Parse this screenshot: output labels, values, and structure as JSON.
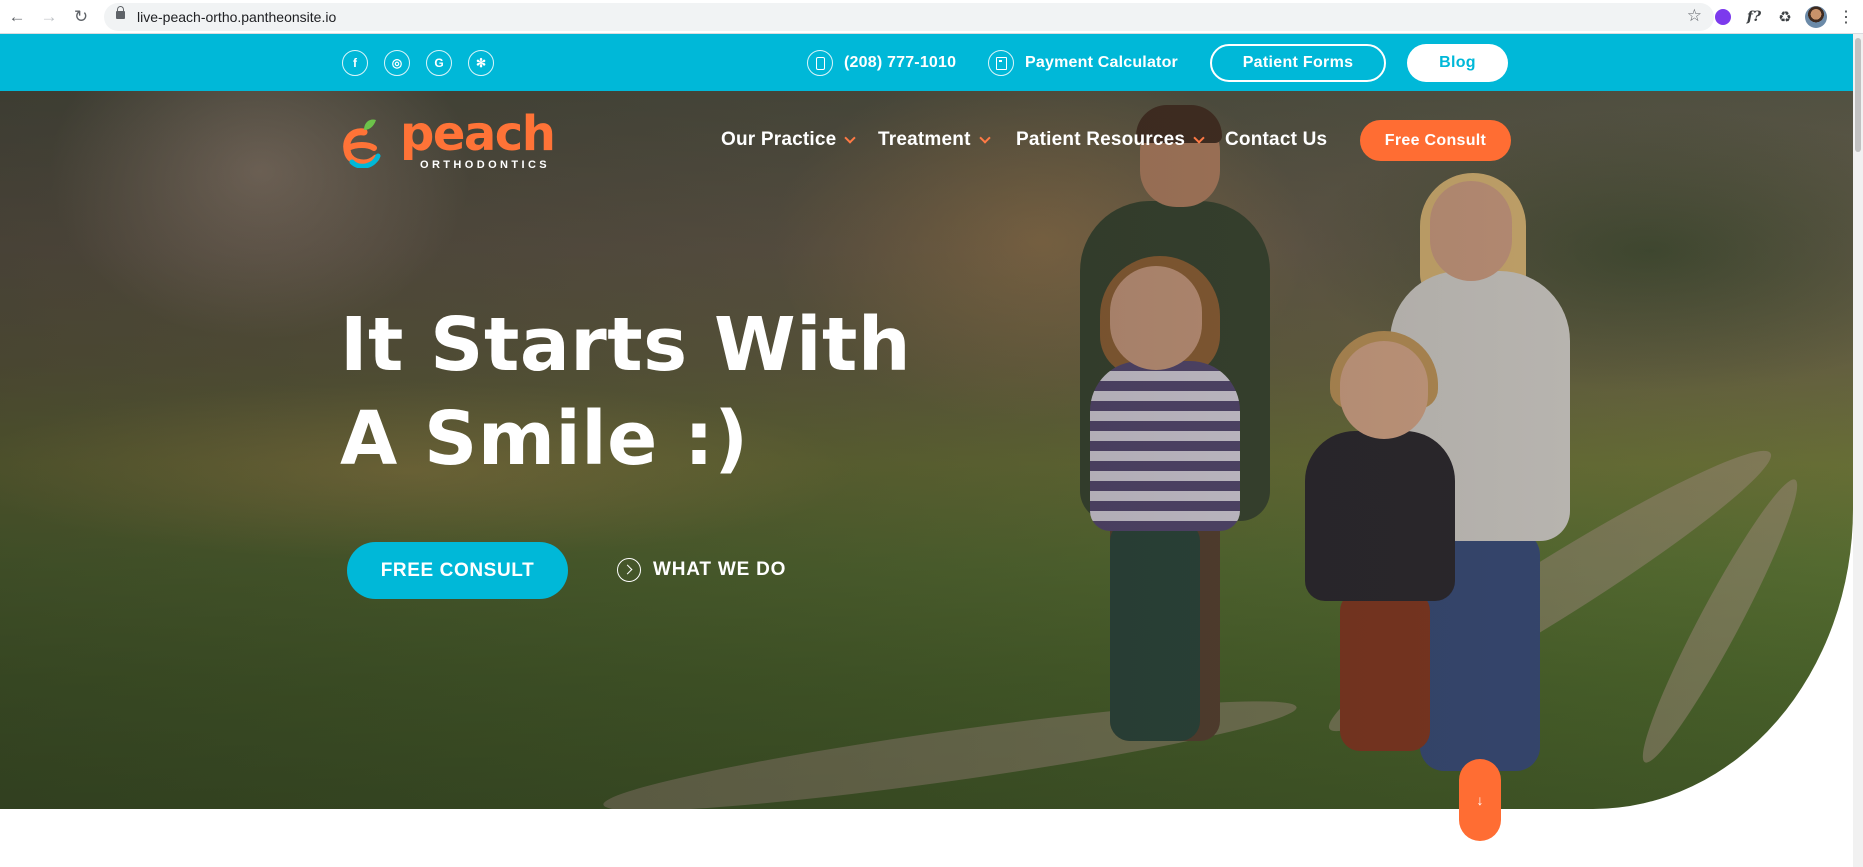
{
  "browser": {
    "url": "live-peach-ortho.pantheonsite.io",
    "icons": [
      "back-arrow-icon",
      "forward-arrow-icon",
      "reload-icon",
      "lock-icon",
      "star-icon",
      "extension-icon",
      "puzzle-icon",
      "profile-avatar",
      "more-menu-icon"
    ],
    "ext_f_label": "f?"
  },
  "topbar": {
    "social": [
      {
        "icon": "facebook-icon",
        "glyph": "f"
      },
      {
        "icon": "instagram-icon",
        "glyph": "◎"
      },
      {
        "icon": "google-icon",
        "glyph": "G"
      },
      {
        "icon": "yelp-icon",
        "glyph": "✻"
      }
    ],
    "phone": "(208) 777-1010",
    "payment": "Payment Calculator",
    "patient_forms": "Patient Forms",
    "blog": "Blog"
  },
  "logo": {
    "name": "peach",
    "subtitle": "ORTHODONTICS"
  },
  "nav": {
    "items": [
      {
        "label": "Our Practice",
        "has_dropdown": true
      },
      {
        "label": "Treatment",
        "has_dropdown": true
      },
      {
        "label": "Patient Resources",
        "has_dropdown": true
      },
      {
        "label": "Contact Us",
        "has_dropdown": false
      }
    ],
    "cta": "Free Consult"
  },
  "hero": {
    "headline_line1": "It Starts With",
    "headline_line2": "A Smile :)",
    "primary_cta": "FREE CONSULT",
    "secondary_cta": "WHAT WE DO",
    "scroll_glyph": "↓"
  },
  "colors": {
    "brand_cyan": "#00b8d8",
    "brand_orange": "#ff6d33",
    "white": "#ffffff"
  }
}
